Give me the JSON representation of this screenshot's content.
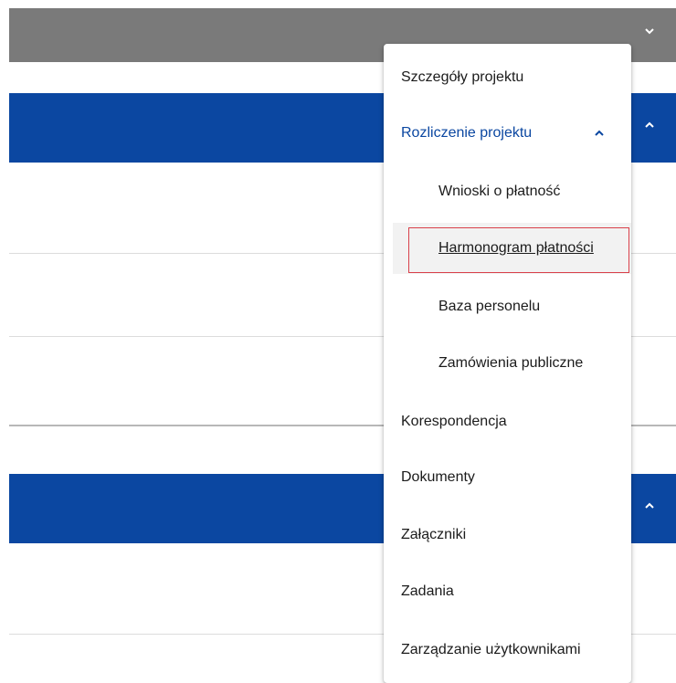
{
  "header": {
    "expand_icon": "chevron-down-icon"
  },
  "sections": [
    {
      "expand_icon": "chevron-up-icon"
    },
    {
      "expand_icon": "chevron-up-icon"
    }
  ],
  "menu": {
    "items": [
      {
        "label": "Szczegóły projektu"
      },
      {
        "label": "Rozliczenie projektu",
        "expanded": true,
        "icon": "chevron-up-icon"
      },
      {
        "label": "Wnioski o płatność",
        "sub": true
      },
      {
        "label": "Harmonogram płatności",
        "sub": true,
        "active": true
      },
      {
        "label": "Baza personelu",
        "sub": true
      },
      {
        "label": "Zamówienia publiczne",
        "sub": true
      },
      {
        "label": "Korespondencja"
      },
      {
        "label": "Dokumenty"
      },
      {
        "label": "Załączniki"
      },
      {
        "label": "Zadania"
      },
      {
        "label": "Zarządzanie użytkownikami"
      }
    ]
  },
  "colors": {
    "primary_blue": "#0b47a1",
    "header_gray": "#7a7a7a",
    "focus_red": "#d9404a"
  }
}
